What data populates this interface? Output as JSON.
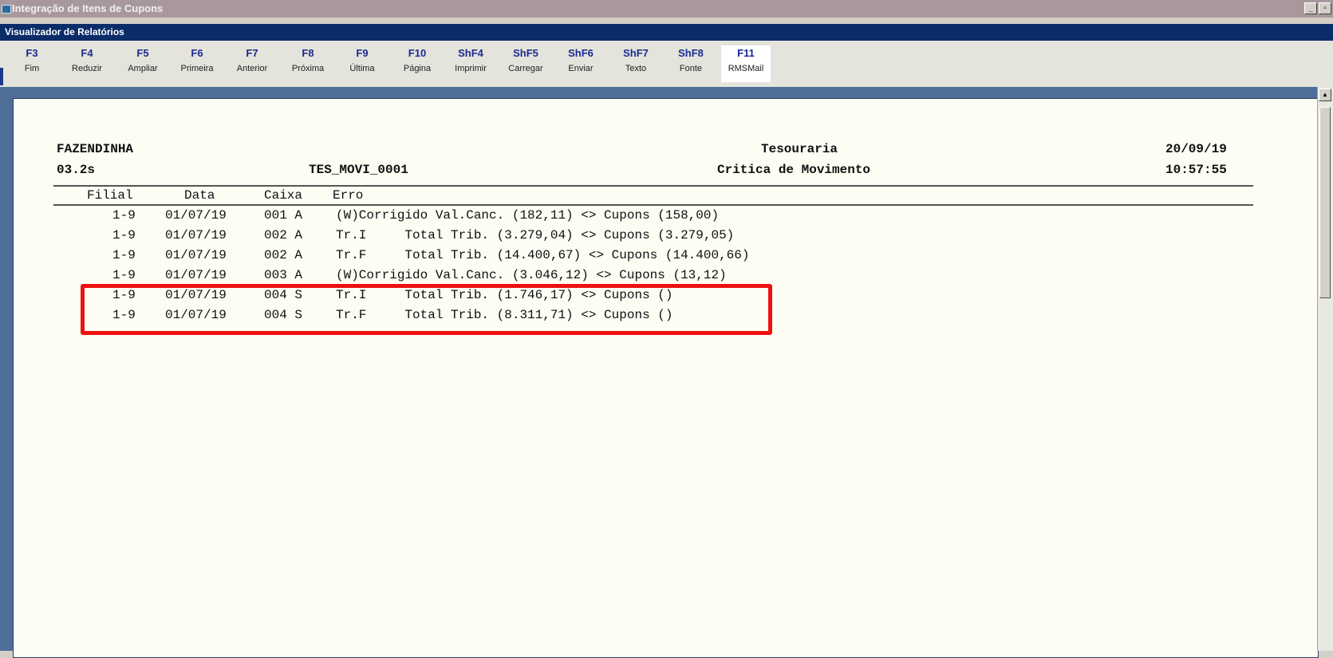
{
  "window": {
    "title": "Integração de Itens de Cupons",
    "controls": [
      "_",
      "▫"
    ]
  },
  "subwindow": {
    "title": "Visualizador de Relatórios"
  },
  "toolbar": [
    {
      "key": "F3",
      "label": "Fim"
    },
    {
      "key": "F4",
      "label": "Reduzir"
    },
    {
      "key": "F5",
      "label": "Ampliar"
    },
    {
      "key": "F6",
      "label": "Primeira"
    },
    {
      "key": "F7",
      "label": "Anterior"
    },
    {
      "key": "F8",
      "label": "Próxima"
    },
    {
      "key": "F9",
      "label": "Última"
    },
    {
      "key": "F10",
      "label": "Página"
    },
    {
      "key": "ShF4",
      "label": "Imprimir"
    },
    {
      "key": "ShF5",
      "label": "Carregar"
    },
    {
      "key": "ShF6",
      "label": "Enviar"
    },
    {
      "key": "ShF7",
      "label": "Texto"
    },
    {
      "key": "ShF8",
      "label": "Fonte"
    },
    {
      "key": "F11",
      "label": "RMSMail"
    }
  ],
  "report": {
    "company": "FAZENDINHA",
    "department": "Tesouraria",
    "date": "20/09/19",
    "version": "03.2s",
    "report_code": "TES_MOVI_0001",
    "report_title": "Critica de Movimento",
    "time": "10:57:55",
    "columns": [
      "Filial",
      "Data",
      "Caixa",
      "Erro"
    ],
    "rows": [
      {
        "filial": "1-9",
        "data": "01/07/19",
        "caixa": "001 A",
        "erro": "(W)Corrigido Val.Canc. (182,11) <> Cupons (158,00)"
      },
      {
        "filial": "1-9",
        "data": "01/07/19",
        "caixa": "002 A",
        "erro": "Tr.I     Total Trib. (3.279,04) <> Cupons (3.279,05)"
      },
      {
        "filial": "1-9",
        "data": "01/07/19",
        "caixa": "002 A",
        "erro": "Tr.F     Total Trib. (14.400,67) <> Cupons (14.400,66)"
      },
      {
        "filial": "1-9",
        "data": "01/07/19",
        "caixa": "003 A",
        "erro": "(W)Corrigido Val.Canc. (3.046,12) <> Cupons (13,12)"
      },
      {
        "filial": "1-9",
        "data": "01/07/19",
        "caixa": "004 S",
        "erro": "Tr.I     Total Trib. (1.746,17) <> Cupons ()"
      },
      {
        "filial": "1-9",
        "data": "01/07/19",
        "caixa": "004 S",
        "erro": "Tr.F     Total Trib. (8.311,71) <> Cupons ()"
      }
    ]
  },
  "colors": {
    "highlight": "#ee1111",
    "paper": "#fdfdf4",
    "toolbar_key": "#1a2a90"
  }
}
